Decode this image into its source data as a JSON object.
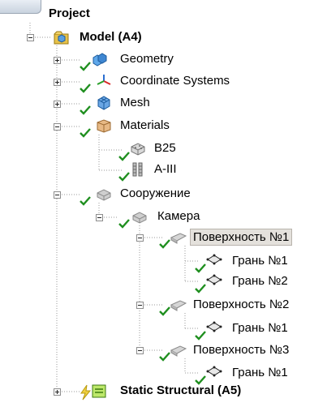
{
  "tree": {
    "root_label": "Project",
    "model_label": "Model (A4)",
    "geometry_label": "Geometry",
    "coord_label": "Coordinate Systems",
    "mesh_label": "Mesh",
    "materials_label": "Materials",
    "mat1_label": "B25",
    "mat2_label": "A-III",
    "structure_label": "Сооружение",
    "camera_label": "Камера",
    "surface1_label": "Поверхность №1",
    "face1_1_label": "Грань №1",
    "face1_2_label": "Грань №2",
    "surface2_label": "Поверхность №2",
    "face2_1_label": "Грань №1",
    "surface3_label": "Поверхность №3",
    "face3_1_label": "Грань №1",
    "static_label": "Static Structural (A5)"
  },
  "colors": {
    "check_green": "#1f8f1f",
    "selection_bg": "#e4e1dc",
    "tree_lines": "#9a9a9a"
  }
}
